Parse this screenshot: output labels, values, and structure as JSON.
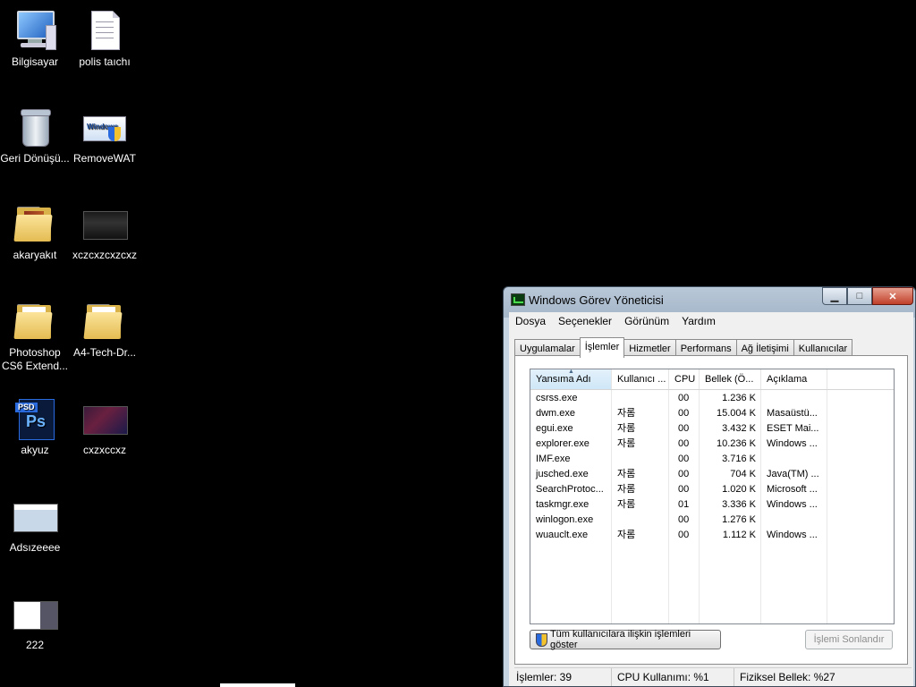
{
  "desktop": {
    "icons": [
      {
        "label": "Bilgisayar"
      },
      {
        "label": "polis taıchı"
      },
      {
        "label": "Geri Dönüşü..."
      },
      {
        "label": "RemoveWAT"
      },
      {
        "label": "akaryakıt"
      },
      {
        "label": "xczcxzcxzcxz"
      },
      {
        "label": "Photoshop CS6 Extend..."
      },
      {
        "label": "A4-Tech-Dr..."
      },
      {
        "label": "akyuz"
      },
      {
        "label": "cxzxccxz"
      },
      {
        "label": "Adsızeeee"
      },
      {
        "label": "222"
      }
    ],
    "removewat_badge": "Windows",
    "psd_tag": "PSD",
    "psd_letters": "Ps"
  },
  "task_manager": {
    "title": "Windows Görev Yöneticisi",
    "window_buttons": {
      "minimize": "▁",
      "maximize": "□",
      "close": "✕"
    },
    "menu": [
      "Dosya",
      "Seçenekler",
      "Görünüm",
      "Yardım"
    ],
    "tabs": [
      "Uygulamalar",
      "İşlemler",
      "Hizmetler",
      "Performans",
      "Ağ İletişimi",
      "Kullanıcılar"
    ],
    "active_tab": "İşlemler",
    "columns": [
      "Yansıma Adı",
      "Kullanıcı ...",
      "CPU",
      "Bellek (Ö...",
      "Açıklama"
    ],
    "rows": [
      {
        "name": "csrss.exe",
        "user": "",
        "cpu": "00",
        "mem": "1.236 K",
        "desc": ""
      },
      {
        "name": "dwm.exe",
        "user": "자롬",
        "cpu": "00",
        "mem": "15.004 K",
        "desc": "Masaüstü..."
      },
      {
        "name": "egui.exe",
        "user": "자롬",
        "cpu": "00",
        "mem": "3.432 K",
        "desc": "ESET Mai..."
      },
      {
        "name": "explorer.exe",
        "user": "자롬",
        "cpu": "00",
        "mem": "10.236 K",
        "desc": "Windows ..."
      },
      {
        "name": "IMF.exe",
        "user": "",
        "cpu": "00",
        "mem": "3.716 K",
        "desc": ""
      },
      {
        "name": "jusched.exe",
        "user": "자롬",
        "cpu": "00",
        "mem": "704 K",
        "desc": "Java(TM) ..."
      },
      {
        "name": "SearchProtoc...",
        "user": "자롬",
        "cpu": "00",
        "mem": "1.020 K",
        "desc": "Microsoft ..."
      },
      {
        "name": "taskmgr.exe",
        "user": "자롬",
        "cpu": "01",
        "mem": "3.336 K",
        "desc": "Windows ..."
      },
      {
        "name": "winlogon.exe",
        "user": "",
        "cpu": "00",
        "mem": "1.276 K",
        "desc": ""
      },
      {
        "name": "wuauclt.exe",
        "user": "자롬",
        "cpu": "00",
        "mem": "1.112 K",
        "desc": "Windows ..."
      }
    ],
    "show_all_button": "Tüm kullanıcılara ilişkin işlemleri göster",
    "end_process_button": "İşlemi Sonlandır",
    "status": {
      "processes": "İşlemler: 39",
      "cpu": "CPU Kullanımı: %1",
      "memory": "Fiziksel Bellek: %27"
    }
  }
}
